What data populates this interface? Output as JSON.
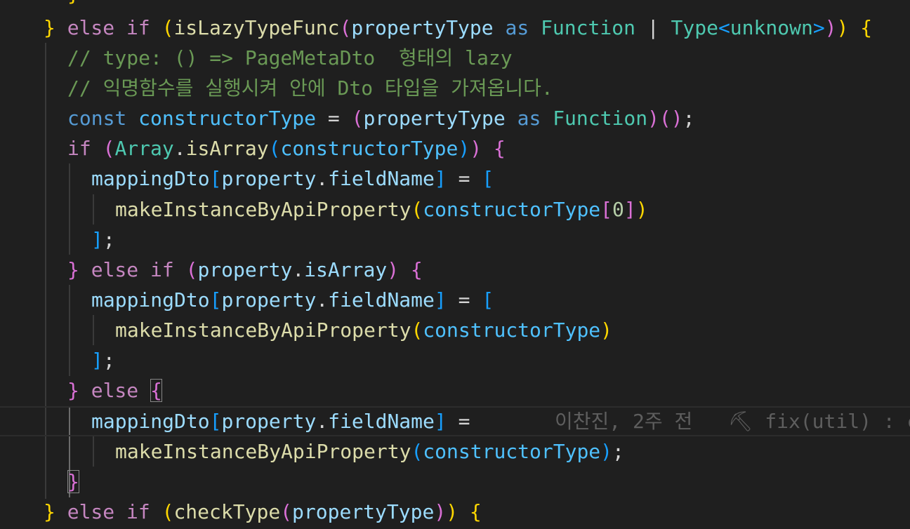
{
  "editor": {
    "lines": [
      {
        "tokens": [
          {
            "t": "}",
            "c": "tok-b1"
          },
          {
            "t": " ",
            "c": "tok-plain"
          },
          {
            "t": "else",
            "c": "tok-kw"
          },
          {
            "t": " ",
            "c": "tok-plain"
          },
          {
            "t": "if",
            "c": "tok-kw"
          },
          {
            "t": " ",
            "c": "tok-plain"
          },
          {
            "t": "(",
            "c": "tok-b1"
          },
          {
            "t": "isLazyTypeFunc",
            "c": "tok-fn"
          },
          {
            "t": "(",
            "c": "tok-b2"
          },
          {
            "t": "propertyType",
            "c": "tok-var"
          },
          {
            "t": " ",
            "c": "tok-plain"
          },
          {
            "t": "as",
            "c": "tok-decl"
          },
          {
            "t": " ",
            "c": "tok-plain"
          },
          {
            "t": "Function",
            "c": "tok-type"
          },
          {
            "t": " ",
            "c": "tok-plain"
          },
          {
            "t": "|",
            "c": "tok-plain"
          },
          {
            "t": " ",
            "c": "tok-plain"
          },
          {
            "t": "Type",
            "c": "tok-type"
          },
          {
            "t": "<",
            "c": "tok-b3"
          },
          {
            "t": "unknown",
            "c": "tok-tp"
          },
          {
            "t": ">",
            "c": "tok-b3"
          },
          {
            "t": ")",
            "c": "tok-b2"
          },
          {
            "t": ")",
            "c": "tok-b1"
          },
          {
            "t": " ",
            "c": "tok-plain"
          },
          {
            "t": "{",
            "c": "tok-b1"
          }
        ]
      },
      {
        "tokens": [
          {
            "t": "// type: () => PageMetaDto  형태의 lazy",
            "c": "tok-cmt"
          }
        ]
      },
      {
        "tokens": [
          {
            "t": "// 익명함수를 실행시켜 안에 Dto 타입을 가져옵니다.",
            "c": "tok-cmt"
          }
        ]
      },
      {
        "tokens": [
          {
            "t": "const",
            "c": "tok-decl"
          },
          {
            "t": " ",
            "c": "tok-plain"
          },
          {
            "t": "constructorType",
            "c": "tok-const"
          },
          {
            "t": " ",
            "c": "tok-plain"
          },
          {
            "t": "=",
            "c": "tok-plain"
          },
          {
            "t": " ",
            "c": "tok-plain"
          },
          {
            "t": "(",
            "c": "tok-b2"
          },
          {
            "t": "propertyType",
            "c": "tok-var"
          },
          {
            "t": " ",
            "c": "tok-plain"
          },
          {
            "t": "as",
            "c": "tok-decl"
          },
          {
            "t": " ",
            "c": "tok-plain"
          },
          {
            "t": "Function",
            "c": "tok-type"
          },
          {
            "t": ")",
            "c": "tok-b2"
          },
          {
            "t": "(",
            "c": "tok-b2"
          },
          {
            "t": ")",
            "c": "tok-b2"
          },
          {
            "t": ";",
            "c": "tok-plain"
          }
        ]
      },
      {
        "tokens": [
          {
            "t": "if",
            "c": "tok-kw"
          },
          {
            "t": " ",
            "c": "tok-plain"
          },
          {
            "t": "(",
            "c": "tok-b2"
          },
          {
            "t": "Array",
            "c": "tok-type"
          },
          {
            "t": ".",
            "c": "tok-plain"
          },
          {
            "t": "isArray",
            "c": "tok-fn"
          },
          {
            "t": "(",
            "c": "tok-b3"
          },
          {
            "t": "constructorType",
            "c": "tok-const"
          },
          {
            "t": ")",
            "c": "tok-b3"
          },
          {
            "t": ")",
            "c": "tok-b2"
          },
          {
            "t": " ",
            "c": "tok-plain"
          },
          {
            "t": "{",
            "c": "tok-b2"
          }
        ]
      },
      {
        "tokens": [
          {
            "t": "mappingDto",
            "c": "tok-var"
          },
          {
            "t": "[",
            "c": "tok-b3"
          },
          {
            "t": "property",
            "c": "tok-var"
          },
          {
            "t": ".",
            "c": "tok-plain"
          },
          {
            "t": "fieldName",
            "c": "tok-prop"
          },
          {
            "t": "]",
            "c": "tok-b3"
          },
          {
            "t": " ",
            "c": "tok-plain"
          },
          {
            "t": "=",
            "c": "tok-plain"
          },
          {
            "t": " ",
            "c": "tok-plain"
          },
          {
            "t": "[",
            "c": "tok-b3"
          }
        ]
      },
      {
        "tokens": [
          {
            "t": "makeInstanceByApiProperty",
            "c": "tok-fn"
          },
          {
            "t": "(",
            "c": "tok-b1"
          },
          {
            "t": "constructorType",
            "c": "tok-const"
          },
          {
            "t": "[",
            "c": "tok-b2"
          },
          {
            "t": "0",
            "c": "tok-num"
          },
          {
            "t": "]",
            "c": "tok-b2"
          },
          {
            "t": ")",
            "c": "tok-b1"
          }
        ]
      },
      {
        "tokens": [
          {
            "t": "]",
            "c": "tok-b3"
          },
          {
            "t": ";",
            "c": "tok-plain"
          }
        ]
      },
      {
        "tokens": [
          {
            "t": "}",
            "c": "tok-b2"
          },
          {
            "t": " ",
            "c": "tok-plain"
          },
          {
            "t": "else",
            "c": "tok-kw"
          },
          {
            "t": " ",
            "c": "tok-plain"
          },
          {
            "t": "if",
            "c": "tok-kw"
          },
          {
            "t": " ",
            "c": "tok-plain"
          },
          {
            "t": "(",
            "c": "tok-b2"
          },
          {
            "t": "property",
            "c": "tok-var"
          },
          {
            "t": ".",
            "c": "tok-plain"
          },
          {
            "t": "isArray",
            "c": "tok-prop"
          },
          {
            "t": ")",
            "c": "tok-b2"
          },
          {
            "t": " ",
            "c": "tok-plain"
          },
          {
            "t": "{",
            "c": "tok-b2"
          }
        ]
      },
      {
        "tokens": [
          {
            "t": "mappingDto",
            "c": "tok-var"
          },
          {
            "t": "[",
            "c": "tok-b3"
          },
          {
            "t": "property",
            "c": "tok-var"
          },
          {
            "t": ".",
            "c": "tok-plain"
          },
          {
            "t": "fieldName",
            "c": "tok-prop"
          },
          {
            "t": "]",
            "c": "tok-b3"
          },
          {
            "t": " ",
            "c": "tok-plain"
          },
          {
            "t": "=",
            "c": "tok-plain"
          },
          {
            "t": " ",
            "c": "tok-plain"
          },
          {
            "t": "[",
            "c": "tok-b3"
          }
        ]
      },
      {
        "tokens": [
          {
            "t": "makeInstanceByApiProperty",
            "c": "tok-fn"
          },
          {
            "t": "(",
            "c": "tok-b1"
          },
          {
            "t": "constructorType",
            "c": "tok-const"
          },
          {
            "t": ")",
            "c": "tok-b1"
          }
        ]
      },
      {
        "tokens": [
          {
            "t": "]",
            "c": "tok-b3"
          },
          {
            "t": ";",
            "c": "tok-plain"
          }
        ]
      },
      {
        "tokens": [
          {
            "t": "}",
            "c": "tok-b2"
          },
          {
            "t": " ",
            "c": "tok-plain"
          },
          {
            "t": "else",
            "c": "tok-kw"
          },
          {
            "t": " ",
            "c": "tok-plain"
          },
          {
            "t": "{",
            "c": "tok-b2",
            "match": true
          }
        ]
      },
      {
        "tokens": [
          {
            "t": "mappingDto",
            "c": "tok-var"
          },
          {
            "t": "[",
            "c": "tok-b3"
          },
          {
            "t": "property",
            "c": "tok-var"
          },
          {
            "t": ".",
            "c": "tok-plain"
          },
          {
            "t": "fieldName",
            "c": "tok-prop"
          },
          {
            "t": "]",
            "c": "tok-b3"
          },
          {
            "t": " ",
            "c": "tok-plain"
          },
          {
            "t": "=",
            "c": "tok-plain"
          }
        ]
      },
      {
        "tokens": [
          {
            "t": "makeInstanceByApiProperty",
            "c": "tok-fn"
          },
          {
            "t": "(",
            "c": "tok-b3"
          },
          {
            "t": "constructorType",
            "c": "tok-const"
          },
          {
            "t": ")",
            "c": "tok-b3"
          },
          {
            "t": ";",
            "c": "tok-plain"
          }
        ]
      },
      {
        "tokens": [
          {
            "t": "}",
            "c": "tok-b2",
            "match": true
          }
        ]
      },
      {
        "tokens": [
          {
            "t": "}",
            "c": "tok-b1"
          },
          {
            "t": " ",
            "c": "tok-plain"
          },
          {
            "t": "else",
            "c": "tok-kw"
          },
          {
            "t": " ",
            "c": "tok-plain"
          },
          {
            "t": "if",
            "c": "tok-kw"
          },
          {
            "t": " ",
            "c": "tok-plain"
          },
          {
            "t": "(",
            "c": "tok-b1"
          },
          {
            "t": "checkType",
            "c": "tok-fn"
          },
          {
            "t": "(",
            "c": "tok-b2"
          },
          {
            "t": "propertyType",
            "c": "tok-var"
          },
          {
            "t": ")",
            "c": "tok-b2"
          },
          {
            "t": ")",
            "c": "tok-b1"
          },
          {
            "t": " ",
            "c": "tok-plain"
          },
          {
            "t": "{",
            "c": "tok-b1"
          }
        ]
      }
    ],
    "blame": {
      "author": "이찬진",
      "age": "2주 전",
      "separator": "•",
      "icon": "hammer-icon",
      "message": "fix(util) : c"
    }
  }
}
